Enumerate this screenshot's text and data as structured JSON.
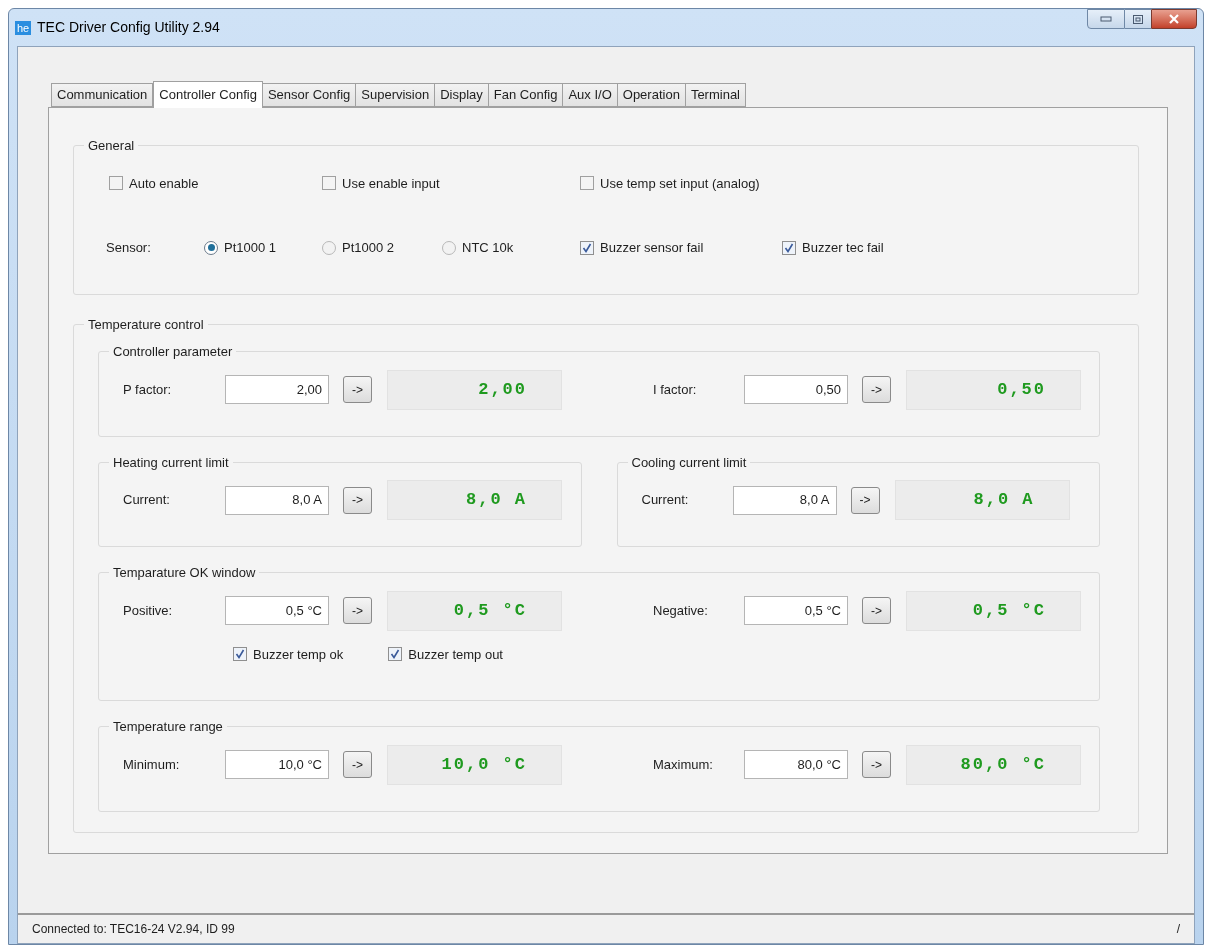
{
  "window": {
    "icon_text": "he",
    "title": "TEC Driver Config Utility 2.94"
  },
  "tabs": [
    {
      "label": "Communication",
      "selected": false
    },
    {
      "label": "Controller Config",
      "selected": true
    },
    {
      "label": "Sensor Config",
      "selected": false
    },
    {
      "label": "Supervision",
      "selected": false
    },
    {
      "label": "Display",
      "selected": false
    },
    {
      "label": "Fan Config",
      "selected": false
    },
    {
      "label": "Aux I/O",
      "selected": false
    },
    {
      "label": "Operation",
      "selected": false
    },
    {
      "label": "Terminal",
      "selected": false
    }
  ],
  "general": {
    "title": "General",
    "checkboxes": [
      {
        "label": "Auto enable",
        "checked": false
      },
      {
        "label": "Use enable input",
        "checked": false
      },
      {
        "label": "Use temp set input (analog)",
        "checked": false
      }
    ],
    "sensor_label": "Sensor:",
    "sensor_options": [
      {
        "label": "Pt1000 1",
        "selected": true
      },
      {
        "label": "Pt1000 2",
        "selected": false
      },
      {
        "label": "NTC 10k",
        "selected": false
      }
    ],
    "buzzer_checkboxes": [
      {
        "label": "Buzzer sensor fail",
        "checked": true
      },
      {
        "label": "Buzzer tec fail",
        "checked": true
      }
    ]
  },
  "temperature_control": {
    "title": "Temperature control",
    "group_rows": [
      {
        "groups": [
          {
            "title": "Controller parameter",
            "fields": [
              {
                "label": "P factor:",
                "value": "2,00",
                "button": "->",
                "display": "2,00"
              },
              {
                "label": "I factor:",
                "value": "0,50",
                "button": "->",
                "display": "0,50"
              }
            ]
          }
        ]
      },
      {
        "groups": [
          {
            "title": "Heating current limit",
            "fields": [
              {
                "label": "Current:",
                "value": "8,0 A",
                "button": "->",
                "display": "8,0 A"
              }
            ]
          },
          {
            "title": "Cooling current limit",
            "fields": [
              {
                "label": "Current:",
                "value": "8,0 A",
                "button": "->",
                "display": "8,0 A"
              }
            ]
          }
        ]
      },
      {
        "groups": [
          {
            "title": "Temparature OK window",
            "fields": [
              {
                "label": "Positive:",
                "value": "0,5 °C",
                "button": "->",
                "display": "0,5 °C"
              },
              {
                "label": "Negative:",
                "value": "0,5 °C",
                "button": "->",
                "display": "0,5 °C"
              }
            ],
            "checkboxes": [
              {
                "label": "Buzzer temp ok",
                "checked": true
              },
              {
                "label": "Buzzer temp out",
                "checked": true
              }
            ]
          }
        ]
      },
      {
        "groups": [
          {
            "title": "Temperature range",
            "fields": [
              {
                "label": "Minimum:",
                "value": "10,0 °C",
                "button": "->",
                "display": "10,0 °C"
              },
              {
                "label": "Maximum:",
                "value": "80,0 °C",
                "button": "->",
                "display": "80,0 °C"
              }
            ]
          }
        ]
      }
    ]
  },
  "status_bar": {
    "text": "Connected to: TEC16-24 V2.94, ID 99",
    "indicator": "/"
  }
}
